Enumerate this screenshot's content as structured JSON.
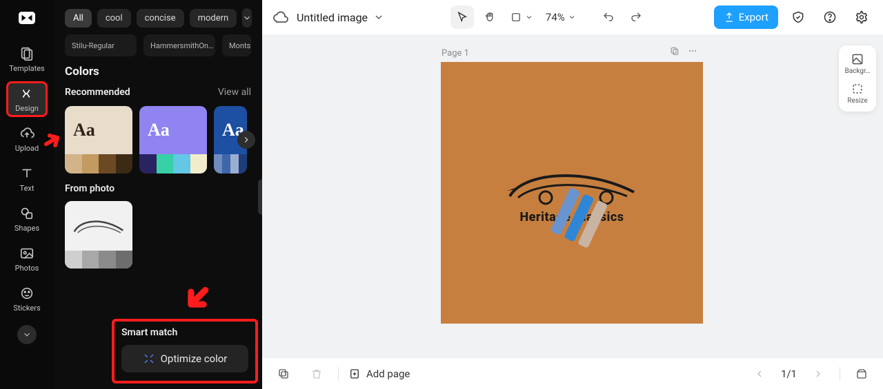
{
  "rail": {
    "items": [
      {
        "label": "Templates"
      },
      {
        "label": "Design"
      },
      {
        "label": "Upload"
      },
      {
        "label": "Text"
      },
      {
        "label": "Shapes"
      },
      {
        "label": "Photos"
      },
      {
        "label": "Stickers"
      }
    ]
  },
  "panel": {
    "tags": {
      "all": "All",
      "cool": "cool",
      "concise": "concise",
      "modern": "modern"
    },
    "fonts": [
      "Stilu-Regular",
      "HammersmithOn…",
      "Monts"
    ],
    "colors_h": "Colors",
    "recommended": "Recommended",
    "viewall": "View all",
    "swatch_aa": "Aa",
    "from_photo": "From photo",
    "smart_match": "Smart match",
    "optimize": "Optimize color"
  },
  "swatches": [
    {
      "bg": "#e8dccb",
      "fg": "#2d2317",
      "bars": [
        "#d3b48a",
        "#c39a5f",
        "#6b4a23",
        "#3c2a14"
      ]
    },
    {
      "bg": "#8f84f0",
      "fg": "#ffffff",
      "bars": [
        "#2a2361",
        "#38d0a6",
        "#63c7e6",
        "#f3eccb"
      ]
    },
    {
      "bg": "#1d4fa2",
      "fg": "#ffffff",
      "bars": [
        "#6f8cc0",
        "#3f66a8",
        "#9aaed2",
        "#1d3d7a"
      ]
    }
  ],
  "thumb_bars": [
    "#cfcfcf",
    "#a8a8a8",
    "#8b8b8b",
    "#6d6d6d"
  ],
  "topbar": {
    "title": "Untitled image",
    "zoom": "74%",
    "export": "Export"
  },
  "canvas": {
    "page_label": "Page 1",
    "brand": "Heritage Classics",
    "bg": "#c77f3f",
    "stripes": [
      "#6a94cf",
      "#2f86d6",
      "#c9b3a3"
    ]
  },
  "sidetools": {
    "background": "Backgr…",
    "resize": "Resize"
  },
  "bottom": {
    "addpage": "Add page",
    "pagecount": "1/1"
  }
}
